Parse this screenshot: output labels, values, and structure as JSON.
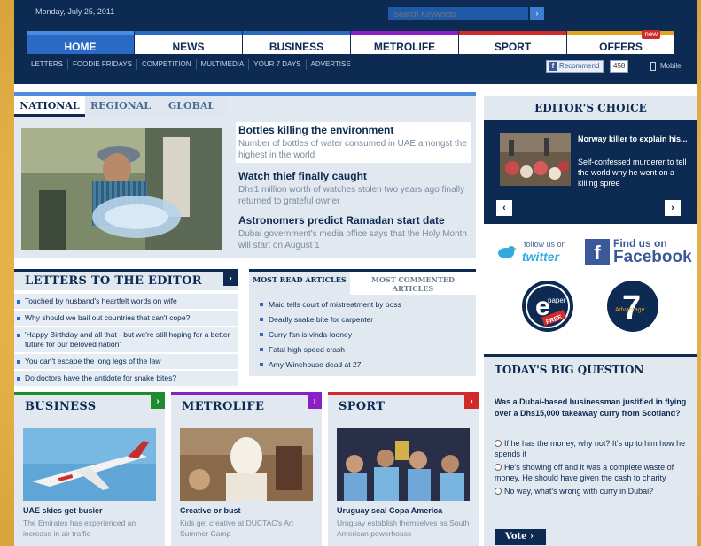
{
  "header": {
    "date": "Monday, July 25, 2011",
    "search_placeholder": "Search Keywords",
    "search_button": "›"
  },
  "nav": {
    "items": [
      "HOME",
      "NEWS",
      "BUSINESS",
      "METROLIFE",
      "SPORT",
      "OFFERS"
    ],
    "new_badge": "new"
  },
  "subnav": {
    "items": [
      "LETTERS",
      "FOODIE FRIDAYS",
      "COMPETITION",
      "MULTIMEDIA",
      "YOUR 7 DAYS",
      "ADVERTISE"
    ],
    "recommend": "Recommend",
    "recommend_count": "458",
    "mobile": "Mobile"
  },
  "featured": {
    "tabs": [
      "NATIONAL",
      "REGIONAL",
      "GLOBAL"
    ],
    "stories": [
      {
        "title": "Bottles killing the environment",
        "desc": "Number of bottles of water consumed in UAE amongst the highest in the world"
      },
      {
        "title": "Watch thief finally caught",
        "desc": "Dhs1 million worth of watches stolen two years ago finally returned to grateful owner"
      },
      {
        "title": "Astronomers predict Ramadan start date",
        "desc": "Dubai government's media office says that the Holy Month will start on August 1"
      }
    ]
  },
  "letters": {
    "title": "LETTERS TO THE EDITOR",
    "items": [
      "Touched by husband's heartfelt words on wife",
      "Why should we bail out countries that can't cope?",
      "'Happy Birthday and all that - but we're still hoping for a better future for our beloved nation'",
      "You can't escape the long legs of the law",
      "Do doctors have the antidote for snake bites?"
    ]
  },
  "most_read": {
    "tabs": [
      "MOST READ ARTICLES",
      "MOST COMMENTED ARTICLES"
    ],
    "items": [
      "Maid tells court of mistreatment by boss",
      "Deadly snake bite for carpenter",
      "Curry fan is vinda-looney",
      "Fatal high speed crash",
      "Amy Winehouse dead at 27"
    ]
  },
  "categories": {
    "business": {
      "title": "BUSINESS",
      "headline": "UAE skies get busier",
      "desc": "The Emirates has experienced an increase in air traffic"
    },
    "metrolife": {
      "title": "METROLIFE",
      "headline": "Creative or bust",
      "desc": "Kids get creative at DUCTAC's Art Summer Camp"
    },
    "sport": {
      "title": "SPORT",
      "headline": "Uruguay seal Copa America",
      "desc": "Uruguay establish themselves as South American powerhouse"
    }
  },
  "editors_choice": {
    "title": "EDITOR'S CHOICE",
    "headline": "Norway killer to explain his...",
    "desc": "Self-confessed murderer to tell the world why he went on a killing spree",
    "prev": "‹",
    "next": "›"
  },
  "social": {
    "twitter_follow": "follow us on",
    "twitter_logo": "twitter",
    "facebook_find": "Find us on",
    "facebook_word": "Facebook"
  },
  "epaper": {
    "line1": "e",
    "line2": "paper",
    "line3": "FREE"
  },
  "seven": {
    "number": "7",
    "word": "Advantage"
  },
  "big_question": {
    "title": "TODAY'S BIG QUESTION",
    "question": "Was a Dubai-based businessman justified in flying over a Dhs15,000 takeaway curry from Scotland?",
    "options": [
      "If he has the money, why not? It's up to him how he spends it",
      "He's showing off and it was a complete waste of money. He should have given the cash to charity",
      "No way, what's wrong with curry in Dubai?"
    ],
    "vote": "Vote"
  },
  "colors": {
    "navy": "#0c2a52",
    "blue": "#2a6ac4",
    "business": "#1f8a2e",
    "metrolife": "#8b1fc4",
    "sport": "#d22a2a",
    "offers": "#e3a21a"
  }
}
